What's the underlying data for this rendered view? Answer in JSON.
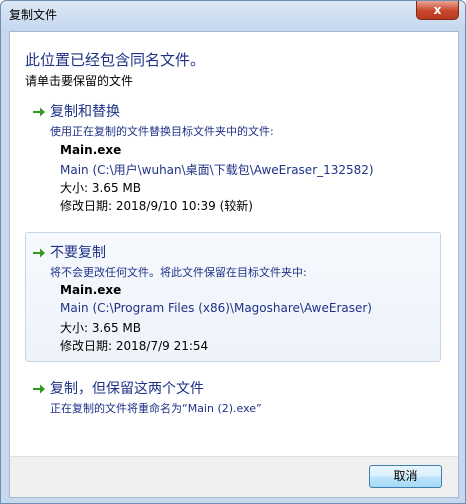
{
  "window": {
    "title": "复制文件",
    "close_label": "x"
  },
  "header": {
    "title": "此位置已经包含同名文件。",
    "subtitle": "请单击要保留的文件"
  },
  "options": [
    {
      "title": "复制和替换",
      "description": "使用正在复制的文件替换目标文件夹中的文件:",
      "file_name": "Main.exe",
      "file_path": "Main (C:\\用户\\wuhan\\桌面\\下载包\\AweEraser_132582)",
      "file_size": "大小: 3.65 MB",
      "file_date": "修改日期: 2018/9/10 10:39 (较新)"
    },
    {
      "title": "不要复制",
      "description": "将不会更改任何文件。将此文件保留在目标文件夹中:",
      "file_name": "Main.exe",
      "file_path": "Main (C:\\Program Files (x86)\\Magoshare\\AweEraser)",
      "file_size": "大小: 3.65 MB",
      "file_date": "修改日期: 2018/7/9 21:54"
    },
    {
      "title": "复制，但保留这两个文件",
      "description": "正在复制的文件将重命名为“Main (2).exe”"
    }
  ],
  "footer": {
    "cancel_label": "取消"
  },
  "colors": {
    "accent_arrow": "#2f9a1f",
    "link_blue": "#1e3287"
  }
}
